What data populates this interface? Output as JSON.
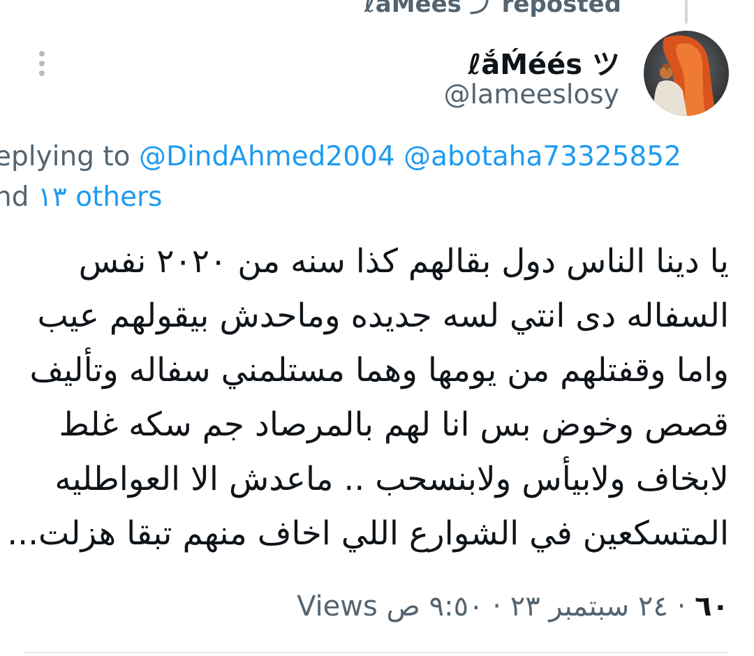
{
  "repost": {
    "text": "ℓaMees ⤴ reposted"
  },
  "author": {
    "display_name": "ℓắḾéés ツ",
    "handle": "@lameeslosy",
    "avatar_icon": "profile-avatar"
  },
  "reply_context": {
    "prefix": "eplying to",
    "mention_1": "@DindAhmed2004",
    "mention_2": "@abotaha73325852",
    "others_prefix": "nd",
    "others": "١٣ others"
  },
  "tweet": {
    "lines": [
      "يا دينا الناس دول بقالهم كذا سنه من ٢٠٢٠ نفس",
      "السفاله دى انتي لسه جديده وماحدش بيقولهم عيب",
      "واما وقفتلهم من يومها وهما مستلمني سفاله وتأليف",
      "قصص وخوض بس انا لهم بالمرصاد جم سكه غلط",
      "لابخاف ولابيأس ولابنسحب .. ماعدش الا العواطليه",
      "المتسكعين في الشوارع اللي اخاف منهم تبقا هزلت..."
    ]
  },
  "meta": {
    "time": "٩:٥٠ ص",
    "separator": "·",
    "date": "٢٤ سبتمبر ٢٣",
    "views_count": "٦٠",
    "views_label": "Views"
  },
  "colors": {
    "accent": "#1d9bf0",
    "secondary_text": "#536471",
    "primary_text": "#0f1419",
    "divider": "#e1e8ed"
  }
}
